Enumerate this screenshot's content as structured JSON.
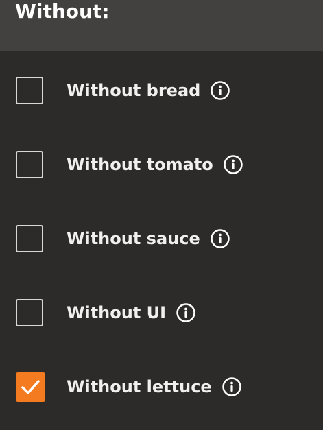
{
  "header": {
    "title": "Without:"
  },
  "options": [
    {
      "label": "Without bread",
      "checked": false
    },
    {
      "label": "Without tomato",
      "checked": false
    },
    {
      "label": "Without sauce",
      "checked": false
    },
    {
      "label": "Without UI",
      "checked": false
    },
    {
      "label": "Without lettuce",
      "checked": true
    }
  ],
  "colors": {
    "accent": "#f47b20",
    "background": "#2d2b29",
    "header_background": "#434140"
  }
}
